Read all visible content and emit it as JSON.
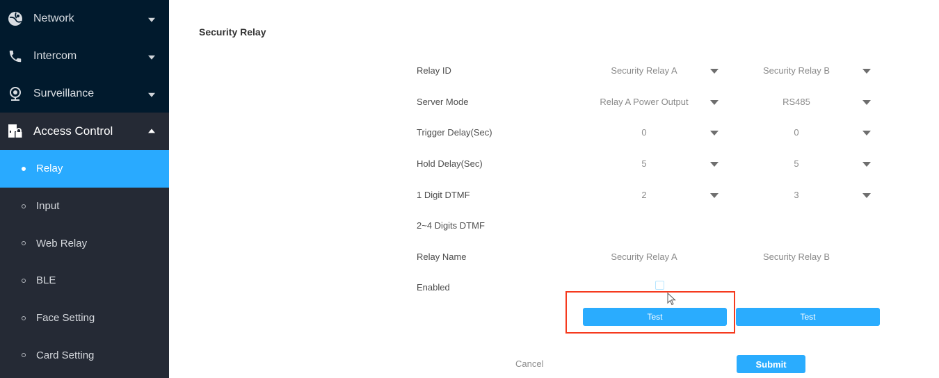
{
  "sidebar": {
    "groups": [
      {
        "label": "Network",
        "icon": "network-icon",
        "expanded": false
      },
      {
        "label": "Intercom",
        "icon": "phone-icon",
        "expanded": false
      },
      {
        "label": "Surveillance",
        "icon": "webcam-icon",
        "expanded": false
      },
      {
        "label": "Access Control",
        "icon": "door-lock-icon",
        "expanded": true
      }
    ],
    "sub_items": [
      {
        "label": "Relay",
        "active": true
      },
      {
        "label": "Input",
        "active": false
      },
      {
        "label": "Web Relay",
        "active": false
      },
      {
        "label": "BLE",
        "active": false
      },
      {
        "label": "Face Setting",
        "active": false
      },
      {
        "label": "Card Setting",
        "active": false
      }
    ]
  },
  "main": {
    "section_title": "Security Relay",
    "rows": [
      {
        "label": "Relay ID",
        "a": "Security Relay A",
        "b": "Security Relay B",
        "dropdown": true
      },
      {
        "label": "Server Mode",
        "a": "Relay A Power Output",
        "b": "RS485",
        "dropdown": true
      },
      {
        "label": "Trigger Delay(Sec)",
        "a": "0",
        "b": "0",
        "dropdown": true
      },
      {
        "label": "Hold Delay(Sec)",
        "a": "5",
        "b": "5",
        "dropdown": true
      },
      {
        "label": "1 Digit DTMF",
        "a": "2",
        "b": "3",
        "dropdown": true
      },
      {
        "label": "2~4 Digits DTMF",
        "a": "",
        "b": "",
        "dropdown": false
      },
      {
        "label": "Relay Name",
        "a": "Security Relay A",
        "b": "Security Relay B",
        "dropdown": false
      },
      {
        "label": "Enabled",
        "a": "",
        "b": "",
        "dropdown": false
      }
    ],
    "enabled_a_checked": false,
    "test_a_label": "Test",
    "test_b_label": "Test",
    "cancel_label": "Cancel",
    "submit_label": "Submit"
  },
  "colors": {
    "accent": "#29aaff",
    "sidebar_dark": "#011a2d",
    "sidebar_sub": "#252a35",
    "highlight": "#f53a1e"
  }
}
